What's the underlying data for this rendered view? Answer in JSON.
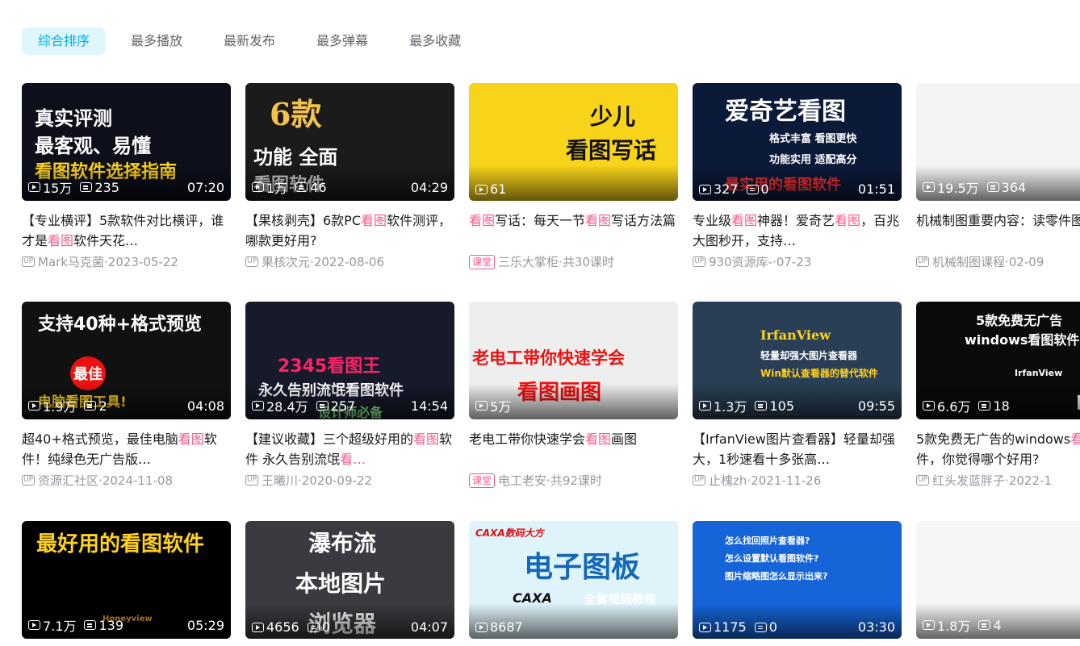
{
  "tabs": [
    {
      "label": "综合排序",
      "active": true
    },
    {
      "label": "最多播放",
      "active": false
    },
    {
      "label": "最新发布",
      "active": false
    },
    {
      "label": "最多弹幕",
      "active": false
    },
    {
      "label": "最多收藏",
      "active": false
    }
  ],
  "videos": [
    {
      "views": "15万",
      "danmaku": "235",
      "duration": "07:20",
      "title_parts": [
        [
          "【专业横评】5款软件对比横评，谁才是",
          0
        ],
        [
          "看图",
          1
        ],
        [
          "软件天花…",
          0
        ]
      ],
      "badge": "UP",
      "author": "Mark马克菌",
      "date": "2023-05-22",
      "thumb_text": [
        "真实评测",
        "最客观、易懂",
        "看图软件选择指南"
      ],
      "bg": "#0d0f1a"
    },
    {
      "views": "1万",
      "danmaku": "46",
      "duration": "04:29",
      "title_parts": [
        [
          "【果核剥壳】6款PC",
          0
        ],
        [
          "看图",
          1
        ],
        [
          "软件测评，哪款更好用?",
          0
        ]
      ],
      "badge": "UP",
      "author": "果核次元",
      "date": "2022-08-06",
      "thumb_text": [
        "6款",
        "功能 全面",
        "看图软件"
      ],
      "bg": "#1b1b1b"
    },
    {
      "views": "61",
      "danmaku": "",
      "duration": "",
      "title_parts": [
        [
          "看图",
          1
        ],
        [
          "写话：每天一节",
          0
        ],
        [
          "看图",
          1
        ],
        [
          "写话方法篇",
          0
        ]
      ],
      "badge": "课堂",
      "author": "三乐大掌柜",
      "date": "共30课时",
      "thumb_text": [
        "少儿",
        "看图写话"
      ],
      "bg": "#f7d31a"
    },
    {
      "views": "327",
      "danmaku": "0",
      "duration": "01:51",
      "title_parts": [
        [
          "专业级",
          0
        ],
        [
          "看图",
          1
        ],
        [
          "神器！爱奇艺",
          0
        ],
        [
          "看图",
          1
        ],
        [
          "，百兆大图秒开，支持…",
          0
        ]
      ],
      "badge": "UP",
      "author": "930资源库-",
      "date": "07-23",
      "thumb_text": [
        "爱奇艺看图",
        "格式丰富 看图更快",
        "功能实用 适配高分",
        "最实用的看图软件"
      ],
      "bg": "#0c1a3a"
    },
    {
      "views": "19.5万",
      "danmaku": "364",
      "duration": "",
      "title_parts": [
        [
          "机械制图重要内容：读零件图",
          0
        ]
      ],
      "badge": "UP",
      "author": "机械制图课程",
      "date": "02-09",
      "thumb_text": [],
      "bg": "#f4f4f4"
    },
    {
      "views": "1.9万",
      "danmaku": "2",
      "duration": "04:08",
      "title_parts": [
        [
          "超40+格式预览，最佳电脑",
          0
        ],
        [
          "看图",
          1
        ],
        [
          "软件！纯绿色无广告版…",
          0
        ]
      ],
      "badge": "UP",
      "author": "资源汇社区",
      "date": "2024-11-08",
      "thumb_text": [
        "支持40种+格式预览",
        "最佳",
        "电脑看图工具!"
      ],
      "bg": "#111"
    },
    {
      "views": "28.4万",
      "danmaku": "257",
      "duration": "14:54",
      "title_parts": [
        [
          "【建议收藏】三个超级好用的",
          0
        ],
        [
          "看图",
          1
        ],
        [
          "软件 永久告别流氓",
          0
        ],
        [
          "看…",
          1
        ]
      ],
      "badge": "UP",
      "author": "王曦川",
      "date": "2020-09-22",
      "thumb_text": [
        "2345看图王",
        "永久告别流氓看图软件",
        "设计师必备"
      ],
      "bg": "#161a2a"
    },
    {
      "views": "5万",
      "danmaku": "",
      "duration": "",
      "title_parts": [
        [
          "老电工带你快速学会",
          0
        ],
        [
          "看图",
          1
        ],
        [
          "画图",
          0
        ]
      ],
      "badge": "课堂",
      "author": "电工老安",
      "date": "共92课时",
      "thumb_text": [
        "老电工带你快速学会",
        "看图画图"
      ],
      "bg": "#eeeeee"
    },
    {
      "views": "1.3万",
      "danmaku": "105",
      "duration": "09:55",
      "title_parts": [
        [
          "【IrfanView图片查看器】轻量却强大，1秒速看十多张高…",
          0
        ]
      ],
      "badge": "UP",
      "author": "止槐zh",
      "date": "2021-11-26",
      "thumb_text": [
        "IrfanView",
        "轻量却强大图片查看器",
        "Win默认查看器的替代软件"
      ],
      "bg": "#2a3f55"
    },
    {
      "views": "6.6万",
      "danmaku": "18",
      "duration": "",
      "title_parts": [
        [
          "5款免费无广告的windows",
          0
        ],
        [
          "看图",
          1
        ],
        [
          "软件，你觉得哪个好用?",
          0
        ]
      ],
      "badge": "UP",
      "author": "红头发蓝胖子",
      "date": "2022-1",
      "thumb_text": [
        "5款免费无广告",
        "windows看图软件",
        "IrfanView",
        "FastSto"
      ],
      "bg": "#0a0a0a"
    },
    {
      "views": "7.1万",
      "danmaku": "139",
      "duration": "05:29",
      "title_parts": [],
      "badge": "",
      "author": "",
      "date": "",
      "thumb_text": [
        "最好用的看图软件",
        "Honeyview"
      ],
      "bg": "#000"
    },
    {
      "views": "4656",
      "danmaku": "0",
      "duration": "04:07",
      "title_parts": [],
      "badge": "",
      "author": "",
      "date": "",
      "thumb_text": [
        "瀑布流",
        "本地图片",
        "浏览器"
      ],
      "bg": "#3a3a40"
    },
    {
      "views": "8687",
      "danmaku": "",
      "duration": "",
      "title_parts": [],
      "badge": "",
      "author": "",
      "date": "",
      "thumb_text": [
        "CAXA数码大方",
        "电子图板",
        "CAXA",
        "全套视频教程"
      ],
      "bg": "#dff3fb"
    },
    {
      "views": "1175",
      "danmaku": "0",
      "duration": "03:30",
      "title_parts": [],
      "badge": "",
      "author": "",
      "date": "",
      "thumb_text": [
        "怎么找回照片查看器?",
        "怎么设置默认看图软件?",
        "图片缩略图怎么显示出来?"
      ],
      "bg": "#1565d8"
    },
    {
      "views": "1.8万",
      "danmaku": "4",
      "duration": "",
      "title_parts": [],
      "badge": "",
      "author": "",
      "date": "",
      "thumb_text": [],
      "bg": "#f6f6f6"
    }
  ]
}
